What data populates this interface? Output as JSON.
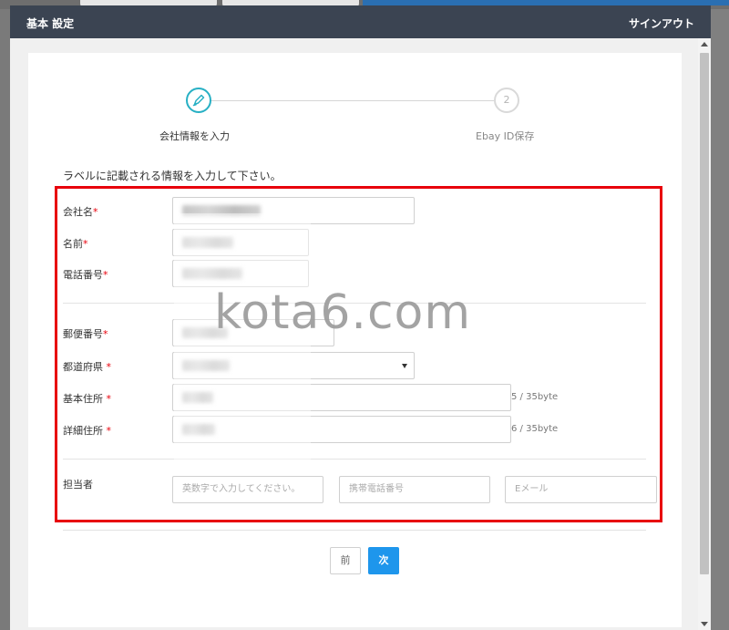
{
  "background": {
    "tab1_label": "",
    "tab2_label": ""
  },
  "modal": {
    "title": "基本 設定",
    "signout_label": "サインアウト"
  },
  "steps": [
    {
      "label": "会社情報を入力",
      "icon": "pencil-icon",
      "state": "active"
    },
    {
      "label": "Ebay ID保存",
      "number": "2",
      "state": "inactive"
    }
  ],
  "instruction": "ラベルに記載される情報を入力して下さい。",
  "form": {
    "company_name_label": "会社名",
    "name_label": "名前",
    "phone_label": "電話番号",
    "postal_label": "郵便番号",
    "prefecture_label": "都道府県 ",
    "address1_label": "基本住所 ",
    "address2_label": "詳細住所 ",
    "required_mark": "*",
    "address1_count": "5 / 35byte",
    "address2_count": "6 / 35byte",
    "contact_label": "担当者",
    "contact_name_placeholder": "英数字で入力してください。",
    "contact_phone_placeholder": "携帯電話番号",
    "contact_email_placeholder": "Eメール"
  },
  "buttons": {
    "prev_label": "前",
    "next_label": "次"
  },
  "watermark": "kota6.com",
  "colors": {
    "header_bg": "#3b4452",
    "accent_teal": "#27b0c4",
    "primary_blue": "#1e96ec",
    "required_red": "#e8000b",
    "highlight_red": "#e8000b"
  }
}
